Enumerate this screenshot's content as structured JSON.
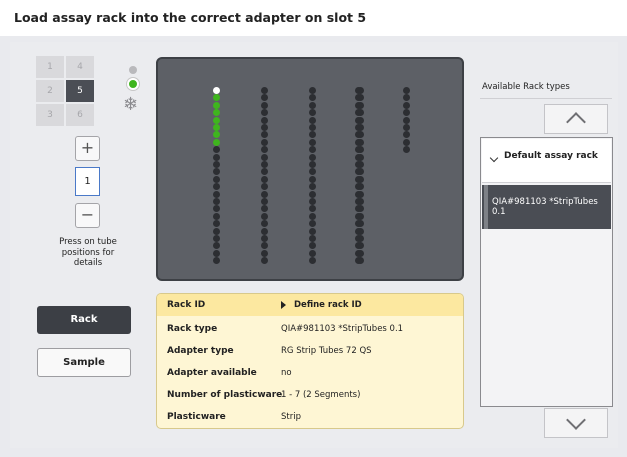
{
  "header": {
    "title": "Load assay rack into the correct adapter on slot 5"
  },
  "slots": [
    {
      "label": "1",
      "active": false
    },
    {
      "label": "4",
      "active": false
    },
    {
      "label": "2",
      "active": false
    },
    {
      "label": "5",
      "active": true
    },
    {
      "label": "3",
      "active": false
    },
    {
      "label": "6",
      "active": false
    }
  ],
  "stepper": {
    "plus": "+",
    "value": "1",
    "minus": "−"
  },
  "hint": "Press on tube positions for details",
  "buttons": {
    "rack": "Rack",
    "sample": "Sample"
  },
  "rack_view": {
    "columns": 6,
    "column_tube_counts": [
      24,
      24,
      24,
      24,
      24,
      9
    ],
    "column_loaded_counts": [
      8,
      0,
      0,
      0,
      0,
      0
    ],
    "colors": {
      "empty": "#2c2e32",
      "loaded": "#3fb51e",
      "first": "#ffffff"
    }
  },
  "info": {
    "rows": [
      {
        "key": "Rack ID",
        "value": "Define rack ID"
      },
      {
        "key": "Rack type",
        "value": "QIA#981103 *StripTubes 0.1"
      },
      {
        "key": "Adapter type",
        "value": "RG Strip Tubes 72 QS"
      },
      {
        "key": "Adapter available",
        "value": "no"
      },
      {
        "key": "Number of plasticware",
        "value": "1 - 7 (2 Segments)"
      },
      {
        "key": "Plasticware",
        "value": "Strip"
      }
    ]
  },
  "rack_types": {
    "label": "Available Rack types",
    "group": "Default assay rack",
    "selected": "QIA#981103 *StripTubes 0.1"
  },
  "icons": {
    "status_gray": "status-dot-icon",
    "status_green": "status-dot-icon",
    "cooling": "snowflake-icon",
    "scroll_up": "chevron-up-icon",
    "scroll_down": "chevron-down-icon",
    "expand": "chevron-down-icon"
  },
  "colors": {
    "accent": "#3fb51e",
    "dark": "#3c3f45",
    "info_bg": "#fef6d4",
    "info_head": "#fce8a0"
  }
}
